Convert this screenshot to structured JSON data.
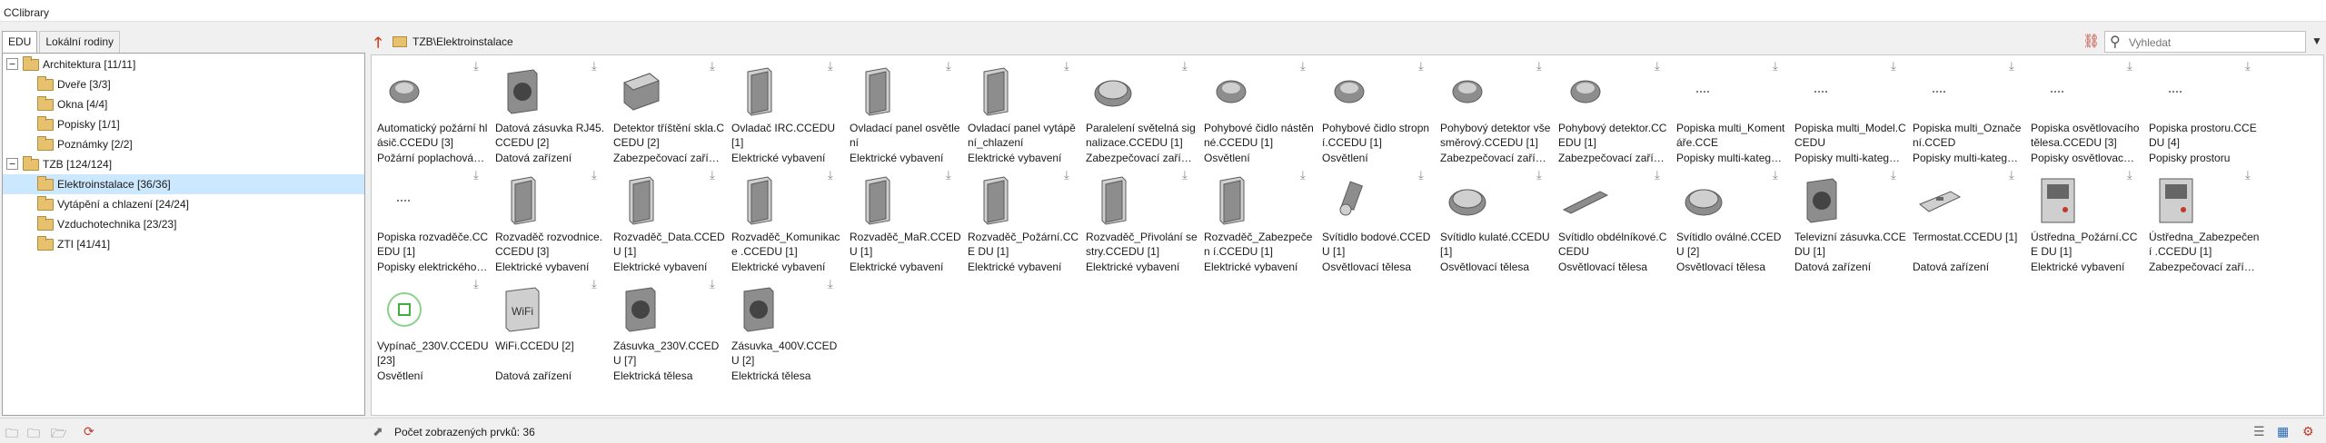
{
  "app": {
    "title": "CClibrary"
  },
  "tabs": [
    {
      "label": "EDU",
      "active": true
    },
    {
      "label": "Lokální rodiny",
      "active": false
    }
  ],
  "tree": [
    {
      "label": "Architektura [11/11]",
      "level": 0,
      "expander": "−",
      "selected": false
    },
    {
      "label": "Dveře [3/3]",
      "level": 1,
      "expander": "",
      "selected": false
    },
    {
      "label": "Okna [4/4]",
      "level": 1,
      "expander": "",
      "selected": false
    },
    {
      "label": "Popisky [1/1]",
      "level": 1,
      "expander": "",
      "selected": false
    },
    {
      "label": "Poznámky [2/2]",
      "level": 1,
      "expander": "",
      "selected": false
    },
    {
      "label": "TZB [124/124]",
      "level": 0,
      "expander": "−",
      "selected": false
    },
    {
      "label": "Elektroinstalace [36/36]",
      "level": 1,
      "expander": "",
      "selected": true
    },
    {
      "label": "Vytápění a chlazení [24/24]",
      "level": 1,
      "expander": "",
      "selected": false
    },
    {
      "label": "Vzduchotechnika [23/23]",
      "level": 1,
      "expander": "",
      "selected": false
    },
    {
      "label": "ZTI [41/41]",
      "level": 1,
      "expander": "",
      "selected": false
    }
  ],
  "path": {
    "text": "TZB\\Elektroinstalace"
  },
  "search": {
    "placeholder": "Vyhledat"
  },
  "items": [
    {
      "name": "Automatický požární hlásič.CCEDU [3]",
      "category": "Požární poplachová…",
      "icon": "fire-detector-icon"
    },
    {
      "name": "Datová zásuvka RJ45.CCEDU [2]",
      "category": "Datová zařízení",
      "icon": "data-socket-icon"
    },
    {
      "name": "Detektor tříštění skla.CCEDU [2]",
      "category": "Zabezpečovací zaříz…",
      "icon": "glass-break-detector-icon"
    },
    {
      "name": "Ovladač IRC.CCEDU [1]",
      "category": "Elektrické vybavení",
      "icon": "irc-controller-icon"
    },
    {
      "name": "Ovladací panel osvětlení",
      "category": "Elektrické vybavení",
      "icon": "lighting-panel-icon"
    },
    {
      "name": "Ovladací panel vytápění_chlazení",
      "category": "Elektrické vybavení",
      "icon": "hvac-panel-icon"
    },
    {
      "name": "Paralelení světelná signalizace.CCEDU [1]",
      "category": "Zabezpečovací zaříz…",
      "icon": "signal-light-icon"
    },
    {
      "name": "Pohybové čidlo nástěnné.CCEDU [1]",
      "category": "Osvětlení",
      "icon": "wall-motion-sensor-icon"
    },
    {
      "name": "Pohybové čidlo stropní.CCEDU [1]",
      "category": "Osvětlení",
      "icon": "ceiling-motion-sensor-icon"
    },
    {
      "name": "Pohybový detektor všesměrový.CCEDU [1]",
      "category": "Zabezpečovací zaříz…",
      "icon": "omni-motion-detector-icon"
    },
    {
      "name": "Pohybový detektor.CCEDU [1]",
      "category": "Zabezpečovací zaříz…",
      "icon": "motion-detector-icon"
    },
    {
      "name": "Popiska multi_Komentáře.CCE",
      "category": "Popisky multi-kateg…",
      "icon": "tag-comments-icon"
    },
    {
      "name": "Popiska multi_Model.CCEDU",
      "category": "Popisky multi-kateg…",
      "icon": "tag-model-icon"
    },
    {
      "name": "Popiska multi_Označení.CCED",
      "category": "Popisky multi-kateg…",
      "icon": "tag-mark-icon"
    },
    {
      "name": "Popiska osvětlovacího tělesa.CCEDU [3]",
      "category": "Popisky osvětlovac…",
      "icon": "tag-lighting-icon"
    },
    {
      "name": "Popiska prostoru.CCEDU [4]",
      "category": "Popisky prostoru",
      "icon": "tag-space-icon"
    },
    {
      "name": "Popiska rozvaděče.CCEDU [1]",
      "category": "Popisky elektrického…",
      "icon": "tag-panel-icon"
    },
    {
      "name": "Rozvaděč rozvodnice.CCEDU [3]",
      "category": "Elektrické vybavení",
      "icon": "distribution-board-icon"
    },
    {
      "name": "Rozvaděč_Data.CCEDU [1]",
      "category": "Elektrické vybavení",
      "icon": "data-cabinet-icon"
    },
    {
      "name": "Rozvaděč_Komunikace .CCEDU [1]",
      "category": "Elektrické vybavení",
      "icon": "comm-cabinet-icon"
    },
    {
      "name": "Rozvaděč_MaR.CCEDU [1]",
      "category": "Elektrické vybavení",
      "icon": "mar-cabinet-icon"
    },
    {
      "name": "Rozvaděč_Požární.CCE DU [1]",
      "category": "Elektrické vybavení",
      "icon": "fire-cabinet-icon"
    },
    {
      "name": "Rozvaděč_Přivolání sestry.CCEDU [1]",
      "category": "Elektrické vybavení",
      "icon": "nurse-call-cabinet-icon"
    },
    {
      "name": "Rozvaděč_Zabezpečen í.CCEDU [1]",
      "category": "Elektrické vybavení",
      "icon": "security-cabinet-icon"
    },
    {
      "name": "Svítidlo bodové.CCEDU [1]",
      "category": "Osvětlovací tělesa",
      "icon": "spot-light-icon"
    },
    {
      "name": "Svítidlo kulaté.CCEDU [1]",
      "category": "Osvětlovací tělesa",
      "icon": "round-light-icon"
    },
    {
      "name": "Svítidlo obdélníkové.CCEDU",
      "category": "Osvětlovací tělesa",
      "icon": "linear-light-icon"
    },
    {
      "name": "Svítidlo oválné.CCEDU [2]",
      "category": "Osvětlovací tělesa",
      "icon": "oval-light-icon"
    },
    {
      "name": "Televizní zásuvka.CCEDU [1]",
      "category": "Datová zařízení",
      "icon": "tv-socket-icon"
    },
    {
      "name": "Termostat.CCEDU [1]",
      "category": "Datová zařízení",
      "icon": "thermostat-icon"
    },
    {
      "name": "Ústředna_Požární.CCE DU [1]",
      "category": "Elektrické vybavení",
      "icon": "fire-control-panel-icon"
    },
    {
      "name": "Ústředna_Zabezpečení .CCEDU [1]",
      "category": "Zabezpečovací zaříz…",
      "icon": "security-control-panel-icon"
    },
    {
      "name": "Vypínač_230V.CCEDU [23]",
      "category": "Osvětlení",
      "icon": "switch-icon"
    },
    {
      "name": "WiFi.CCEDU [2]",
      "category": "Datová zařízení",
      "icon": "wifi-icon"
    },
    {
      "name": "Zásuvka_230V.CCEDU [7]",
      "category": "Elektrická tělesa",
      "icon": "socket-230v-icon"
    },
    {
      "name": "Zásuvka_400V.CCEDU [2]",
      "category": "Elektrická tělesa",
      "icon": "socket-400v-icon"
    }
  ],
  "status": {
    "text": "Počet zobrazených prvků: 36"
  },
  "colors": {
    "accent": "#cce8ff",
    "up_arrow": "#d23c1a",
    "folder": "#e7c16d"
  }
}
